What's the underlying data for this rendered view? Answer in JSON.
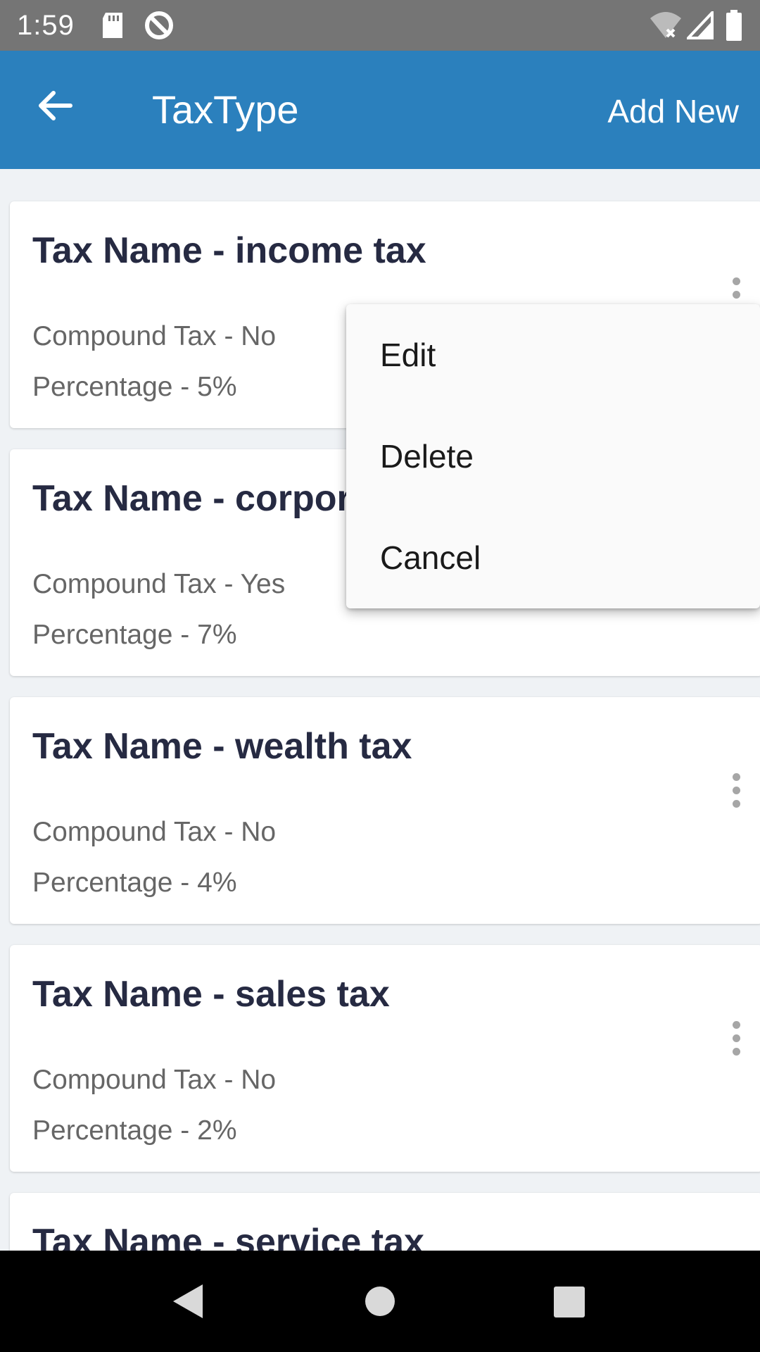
{
  "status_bar": {
    "time": "1:59",
    "icons": [
      "sd-card-icon",
      "do-not-disturb-icon",
      "wifi-off-icon",
      "signal-icon",
      "battery-icon"
    ]
  },
  "app_bar": {
    "back_icon": "arrow-left-icon",
    "title": "TaxType",
    "action_label": "Add New",
    "color": "#2b80bd"
  },
  "tax_list": [
    {
      "title": "Tax Name - income tax",
      "compound": "Compound Tax - No",
      "percentage": "Percentage  - 5%"
    },
    {
      "title": "Tax Name - corpor",
      "compound": "Compound Tax - Yes",
      "percentage": "Percentage  - 7%"
    },
    {
      "title": "Tax Name - wealth tax",
      "compound": "Compound Tax - No",
      "percentage": "Percentage  - 4%"
    },
    {
      "title": "Tax Name - sales tax",
      "compound": "Compound Tax - No",
      "percentage": "Percentage  - 2%"
    },
    {
      "title": "Tax Name - service tax"
    }
  ],
  "popup_menu": {
    "items": [
      "Edit",
      "Delete",
      "Cancel"
    ]
  },
  "nav_bar": {
    "icons": [
      "back-triangle-icon",
      "home-circle-icon",
      "recents-square-icon"
    ]
  }
}
